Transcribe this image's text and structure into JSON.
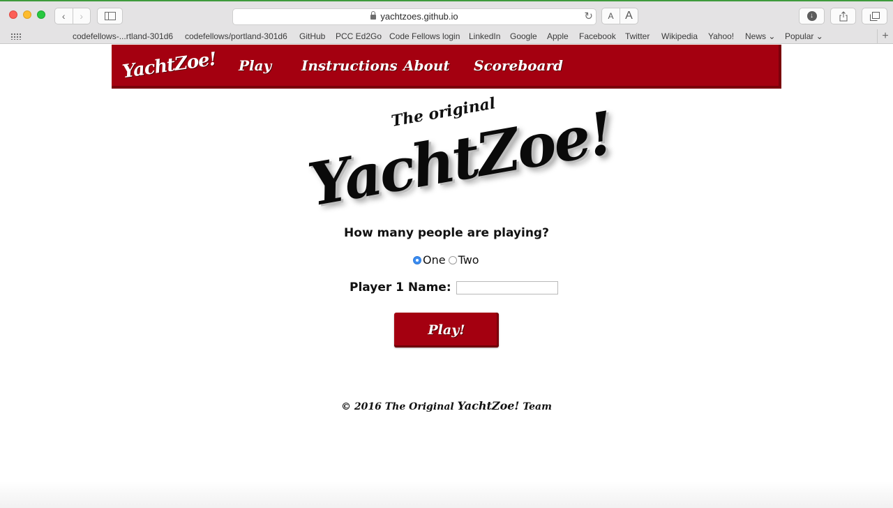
{
  "browser": {
    "url": "yachtzoes.github.io",
    "font_small": "A",
    "font_large": "A",
    "bookmarks": [
      "codefellows-...rtland-301d6",
      "codefellows/portland-301d6",
      "GitHub",
      "PCC Ed2Go",
      "Code Fellows login",
      "LinkedIn",
      "Google",
      "Apple",
      "Facebook",
      "Twitter",
      "Wikipedia",
      "Yahoo!",
      "News ⌄",
      "Popular ⌄"
    ]
  },
  "nav": {
    "logo": "YachtZoe!",
    "links": [
      "Play",
      "Instructions",
      "About",
      "Scoreboard"
    ]
  },
  "hero": {
    "subtitle": "The original",
    "title": "YachtZoe!"
  },
  "form": {
    "question": "How many people are playing?",
    "option_one": "One",
    "option_two": "Two",
    "selected": "One",
    "player_label": "Player 1 Name:",
    "player_value": "",
    "play_button": "Play!"
  },
  "footer": {
    "prefix": "© 2016 The Original",
    "brand": "YachtZoe!",
    "suffix": "Team"
  },
  "colors": {
    "brand_red": "#a40010",
    "radio_blue": "#3b8cf0"
  }
}
